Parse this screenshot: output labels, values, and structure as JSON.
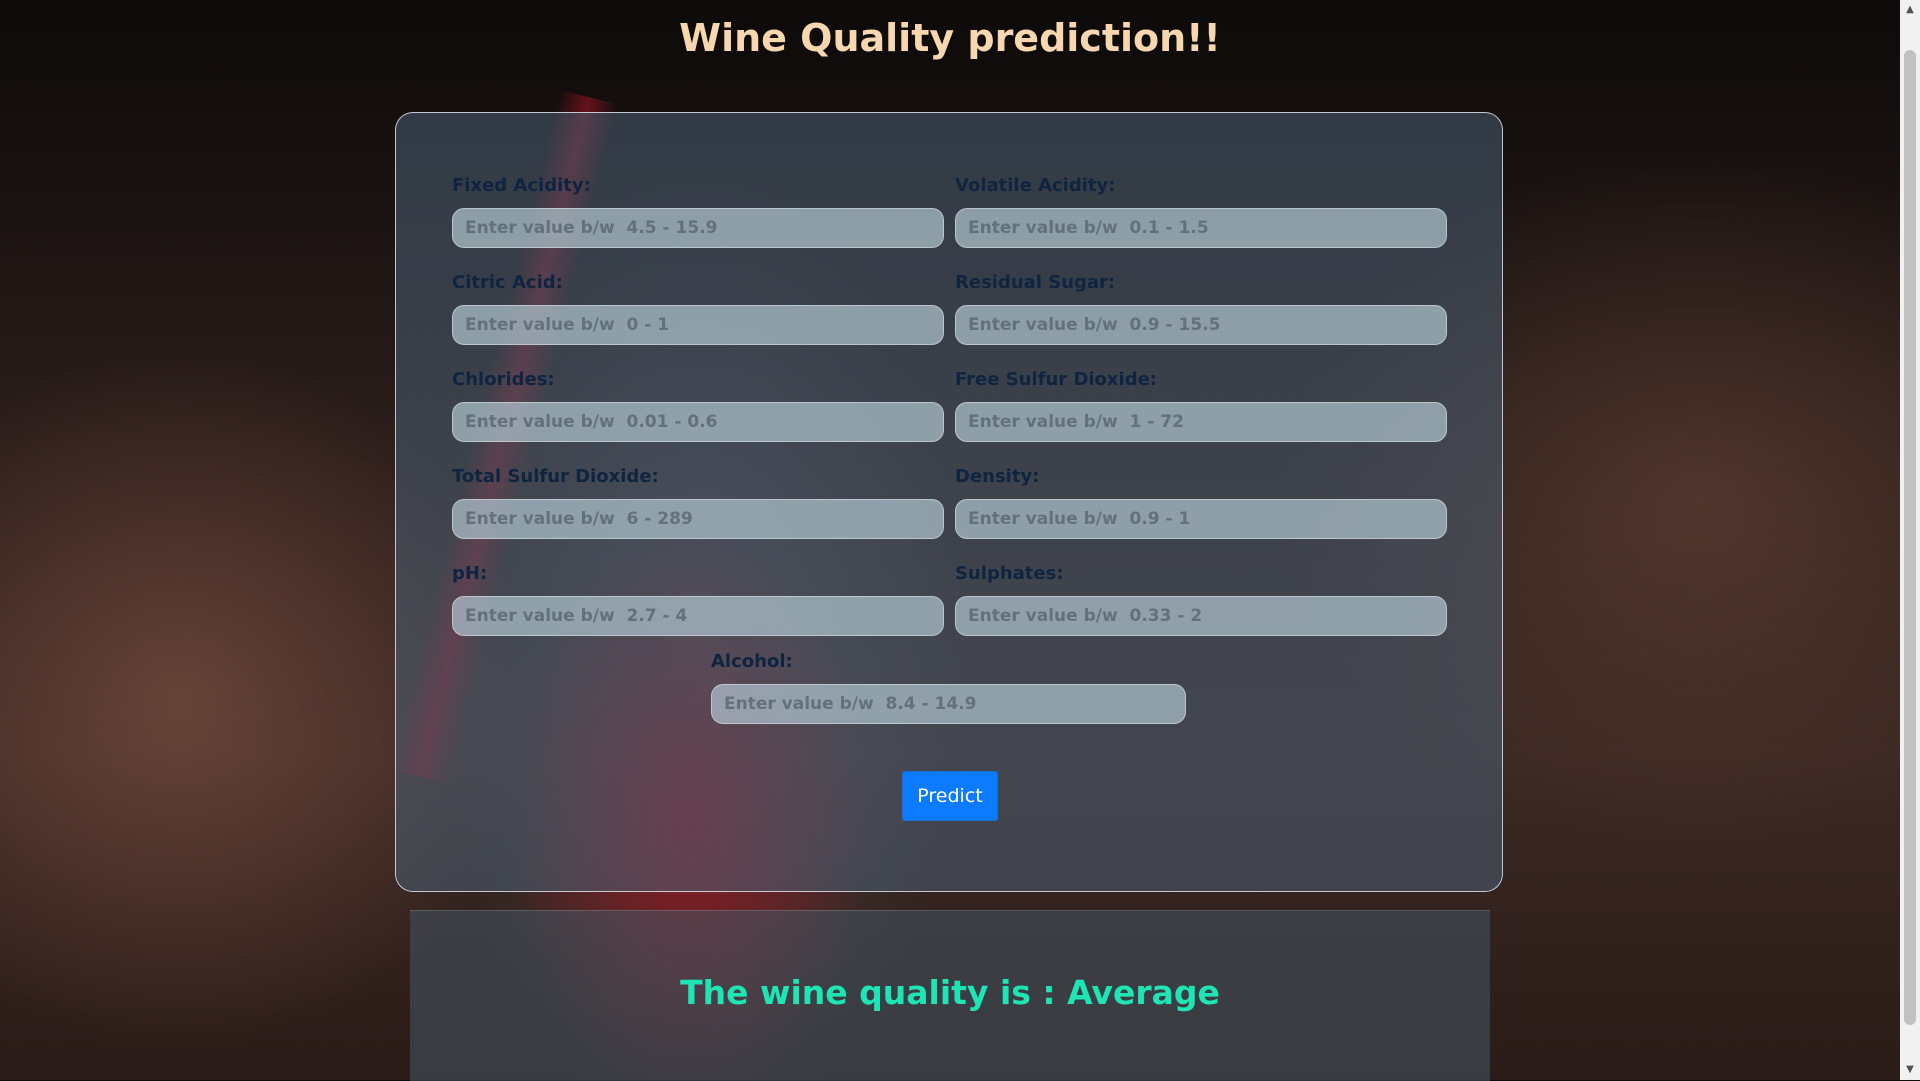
{
  "page": {
    "title": "Wine Quality prediction!!"
  },
  "form": {
    "fields": [
      {
        "label": "Fixed Acidity:",
        "placeholder": "Enter value b/w  4.5 - 15.9"
      },
      {
        "label": "Volatile Acidity:",
        "placeholder": "Enter value b/w  0.1 - 1.5"
      },
      {
        "label": "Citric Acid:",
        "placeholder": "Enter value b/w  0 - 1"
      },
      {
        "label": "Residual Sugar:",
        "placeholder": "Enter value b/w  0.9 - 15.5"
      },
      {
        "label": "Chlorides:",
        "placeholder": "Enter value b/w  0.01 - 0.6"
      },
      {
        "label": "Free Sulfur Dioxide:",
        "placeholder": "Enter value b/w  1 - 72"
      },
      {
        "label": "Total Sulfur Dioxide:",
        "placeholder": "Enter value b/w  6 - 289"
      },
      {
        "label": "Density:",
        "placeholder": "Enter value b/w  0.9 - 1"
      },
      {
        "label": "pH:",
        "placeholder": "Enter value b/w  2.7 - 4"
      },
      {
        "label": "Sulphates:",
        "placeholder": "Enter value b/w  0.33 - 2"
      },
      {
        "label": "Alcohol:",
        "placeholder": "Enter value b/w  8.4 - 14.9"
      }
    ],
    "submit_label": "Predict"
  },
  "result": {
    "text": "The wine quality is : Average"
  },
  "colors": {
    "title": "#f7d7b0",
    "button": "#0d7bff",
    "result": "#1de6b4"
  }
}
